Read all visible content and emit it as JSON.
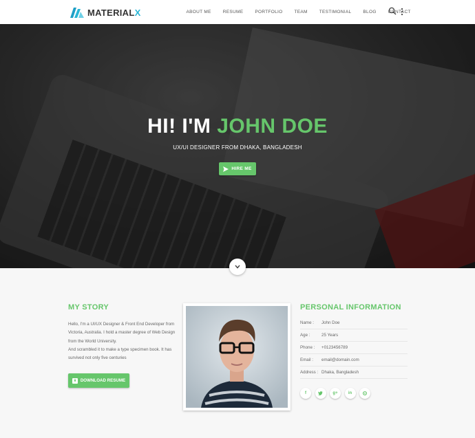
{
  "brand": {
    "logo_main": "MATERIAL",
    "logo_accent": "X"
  },
  "nav": {
    "items": [
      "ABOUT ME",
      "RESUME",
      "PORTFOLIO",
      "TEAM",
      "TESTIMONIAL",
      "BLOG",
      "CONTACT"
    ]
  },
  "hero": {
    "greeting": "HI! I'M",
    "name": "JOHN DOE",
    "subtitle": "UX/UI DESIGNER FROM DHAKA, BANGLADESH",
    "cta": "HIRE ME"
  },
  "story": {
    "title": "MY STORY",
    "line1": "Hello, I'm a UI/UX Designer & Front End Developer from",
    "line2": "Victoria, Australia. I hold a master degree of Web Design",
    "line3": "from the World University.",
    "line4": "And scrambled it to make a type specimen book. It has",
    "line5": "survived not only five centuries",
    "download": "DOWNLOAD RESUME"
  },
  "personal": {
    "title": "PERSONAL INFORMATION",
    "rows": [
      {
        "label": "Name :",
        "value": "John Doe"
      },
      {
        "label": "Age :",
        "value": "25 Years"
      },
      {
        "label": "Phone :",
        "value": "+0123456789"
      },
      {
        "label": "Email :",
        "value": "email@domain.com"
      },
      {
        "label": "Address :",
        "value": "Dhaka, Bangladesh"
      }
    ],
    "social": [
      "f",
      "t",
      "g+",
      "in",
      "dribbble"
    ]
  },
  "colors": {
    "accent": "#66c66b",
    "logo_accent": "#29b6d6"
  }
}
